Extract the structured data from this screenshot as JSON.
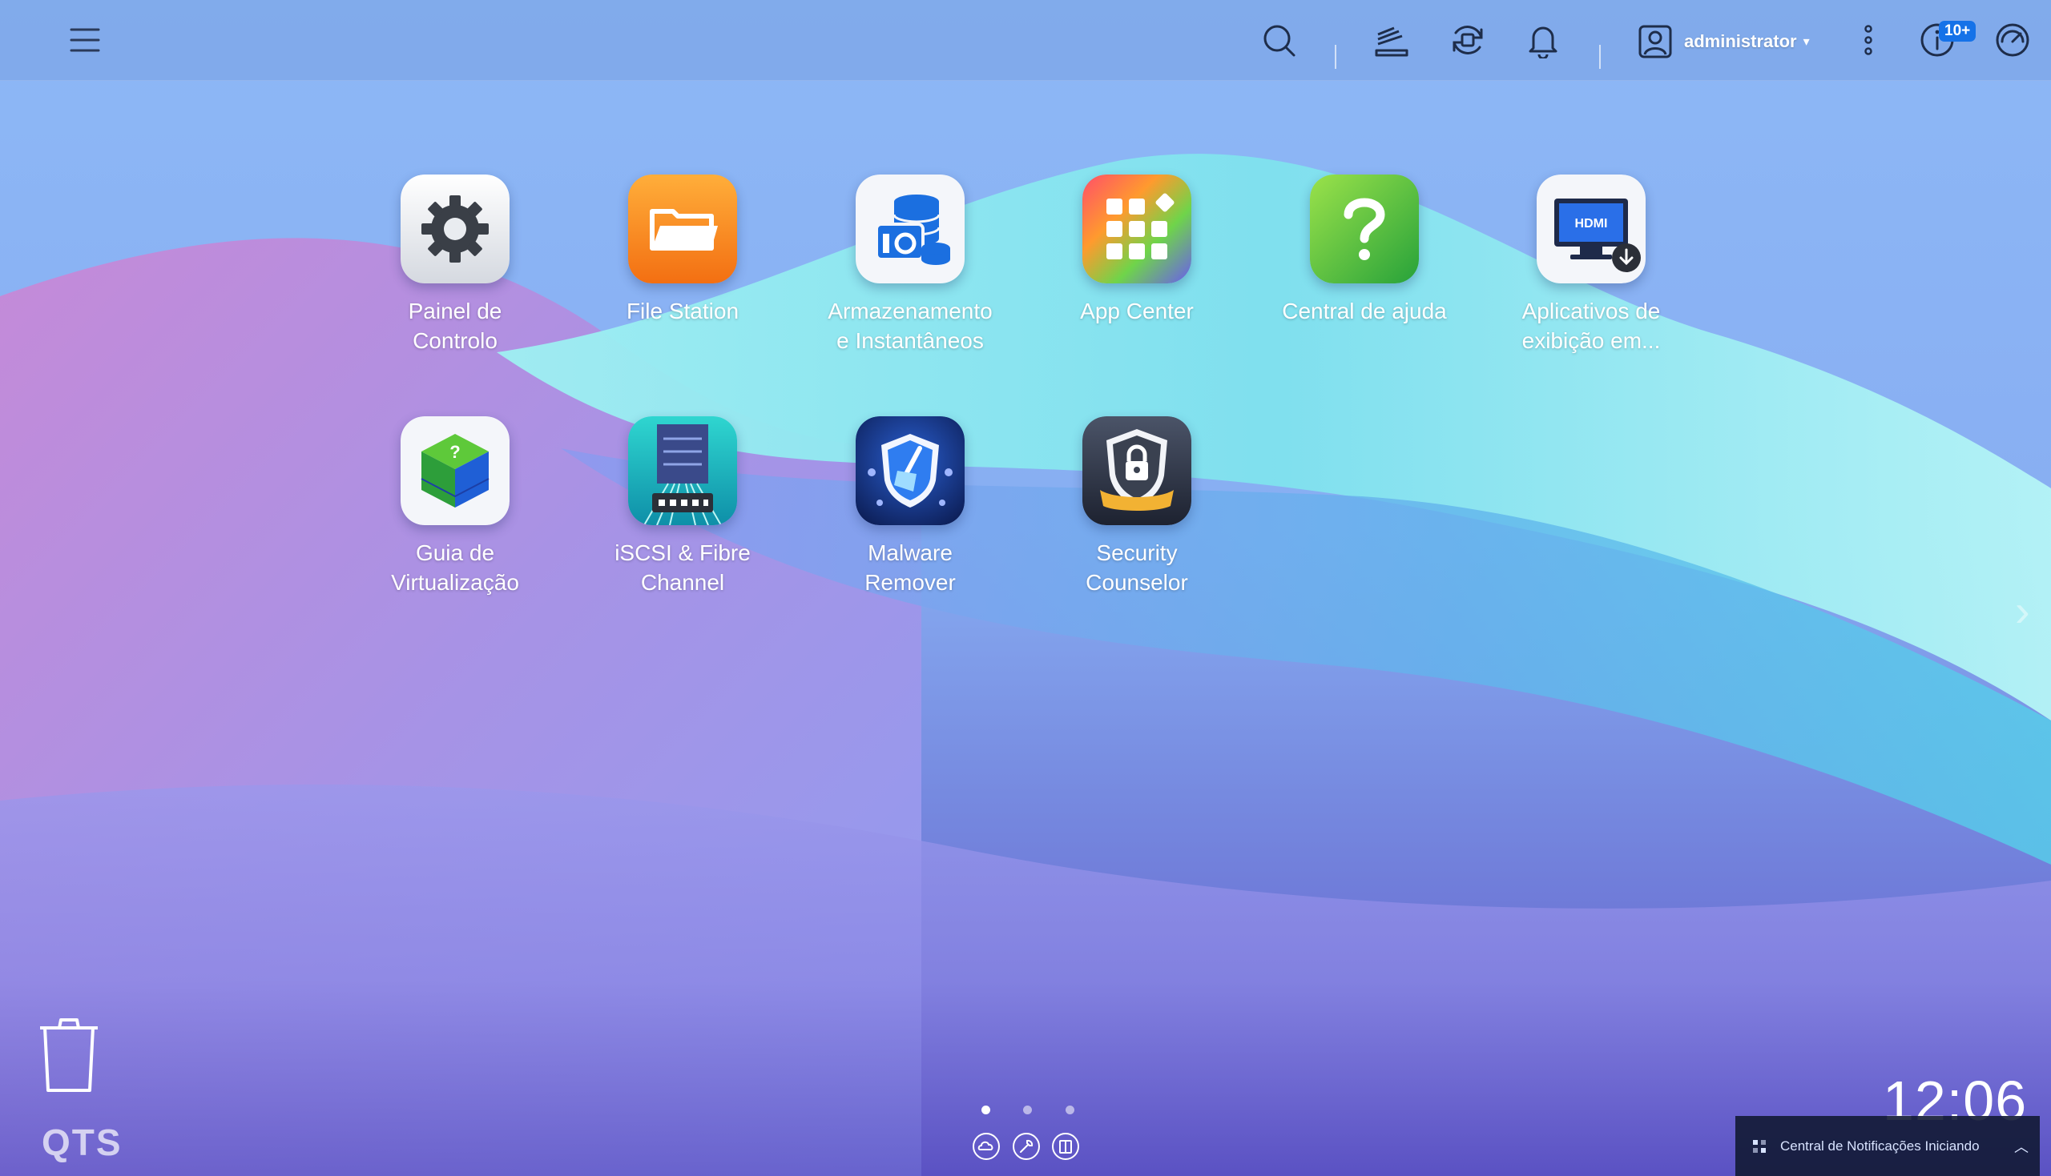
{
  "topbar": {
    "user_name": "administrator",
    "user_caret": "▾",
    "info_badge": "10+"
  },
  "apps": [
    {
      "label": "Painel de\nControlo",
      "icon": "gear-icon"
    },
    {
      "label": "File Station",
      "icon": "folder-icon"
    },
    {
      "label": "Armazenamento\ne Instantâneos",
      "icon": "storage-database-icon"
    },
    {
      "label": "App Center",
      "icon": "app-grid-icon"
    },
    {
      "label": "Central de ajuda",
      "icon": "question-mark-icon"
    },
    {
      "label": "Aplicativos de\nexibição em...",
      "icon": "hdmi-monitor-icon"
    },
    {
      "label": "Guia de\nVirtualização",
      "icon": "cube-icon"
    },
    {
      "label": "iSCSI & Fibre\nChannel",
      "icon": "server-icon"
    },
    {
      "label": "Malware\nRemover",
      "icon": "shield-broom-icon"
    },
    {
      "label": "Security\nCounselor",
      "icon": "shield-lock-icon"
    }
  ],
  "desktop": {
    "logo": "QTS",
    "clock": "12:06",
    "right_arrow": "›"
  },
  "notification": {
    "text": "Central de Notificações Iniciando",
    "toggle": "︿"
  },
  "colors": {
    "wallpaper_base": "#7aa6ef",
    "wave_cyan": "#7fe0ee",
    "wave_purple": "#b08be0",
    "deep_purple": "#5e55c4",
    "badge_blue": "#1572e8",
    "toast_bg": "#121a34"
  }
}
